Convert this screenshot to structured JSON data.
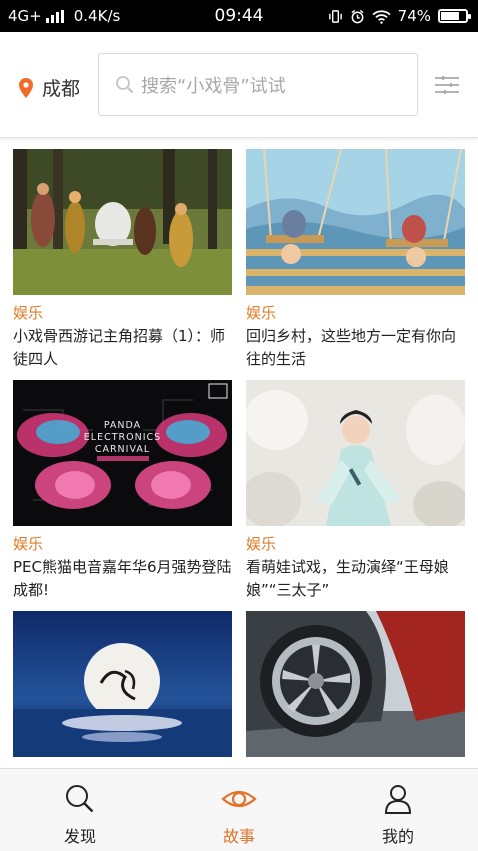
{
  "status_bar": {
    "network": "4G+",
    "speed": "0.4K/s",
    "time": "09:44",
    "battery": "74%",
    "battery_level": 0.74
  },
  "header": {
    "city": "成都",
    "search_placeholder": "搜索“小戏骨”试试",
    "accent_color": "#e0742a"
  },
  "feed": [
    {
      "tag": "娱乐",
      "title": "小戏骨西游记主角招募（1）：师徒四人"
    },
    {
      "tag": "娱乐",
      "title": "回归乡村，这些地方一定有你向往的生活"
    },
    {
      "tag": "娱乐",
      "title": "PEC熊猫电音嘉年华6月强势登陆成都!"
    },
    {
      "tag": "娱乐",
      "title": "看萌娃试戏，生动演绎“王母娘娘”“三太子”"
    },
    {
      "tag": "",
      "title": ""
    },
    {
      "tag": "",
      "title": ""
    }
  ],
  "image_text": {
    "pec_line1": "PANDA",
    "pec_line2": "ELECTRONICS",
    "pec_line3": "CARNIVAL"
  },
  "bottom_nav": [
    {
      "label": "发现",
      "icon": "search-icon",
      "active": false
    },
    {
      "label": "故事",
      "icon": "eye-icon",
      "active": true
    },
    {
      "label": "我的",
      "icon": "person-icon",
      "active": false
    }
  ]
}
